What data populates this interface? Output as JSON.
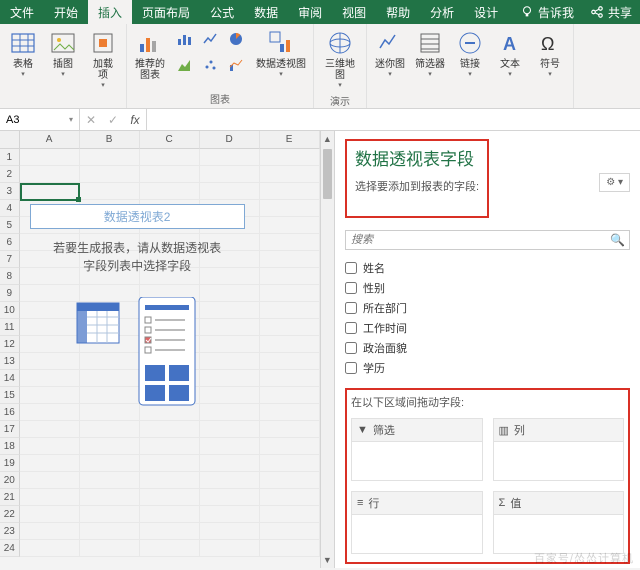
{
  "menu": {
    "tabs": [
      "文件",
      "开始",
      "插入",
      "页面布局",
      "公式",
      "数据",
      "审阅",
      "视图",
      "帮助",
      "分析",
      "设计"
    ],
    "active_index": 2,
    "tell_me": "告诉我",
    "share": "共享"
  },
  "ribbon": {
    "group1": {
      "b0": "表格",
      "b1": "插图",
      "b2": "加载\n项"
    },
    "group2": {
      "label": "图表",
      "b0": "推荐的\n图表",
      "b1": "数据透视图",
      "b2": "三维地\n图",
      "sub": "演示"
    },
    "group3": {
      "b0": "迷你图",
      "b1": "筛选器",
      "b2": "链接",
      "b3": "文本",
      "b4": "符号"
    }
  },
  "formula": {
    "namebox": "A3",
    "fx": "fx"
  },
  "sheet": {
    "cols": [
      "A",
      "B",
      "C",
      "D",
      "E"
    ],
    "pivot_title": "数据透视表2",
    "pivot_msg_l1": "若要生成报表，请从数据透视表",
    "pivot_msg_l2": "字段列表中选择字段"
  },
  "pane": {
    "title": "数据透视表字段",
    "subtitle": "选择要添加到报表的字段:",
    "search_placeholder": "搜索",
    "fields": [
      "姓名",
      "性别",
      "所在部门",
      "工作时间",
      "政治面貌",
      "学历"
    ],
    "areas_title": "在以下区域间拖动字段:",
    "area_filter": "筛选",
    "area_columns": "列",
    "area_rows": "行",
    "area_values": "值"
  },
  "watermark": "百家号/怂怂计算机"
}
